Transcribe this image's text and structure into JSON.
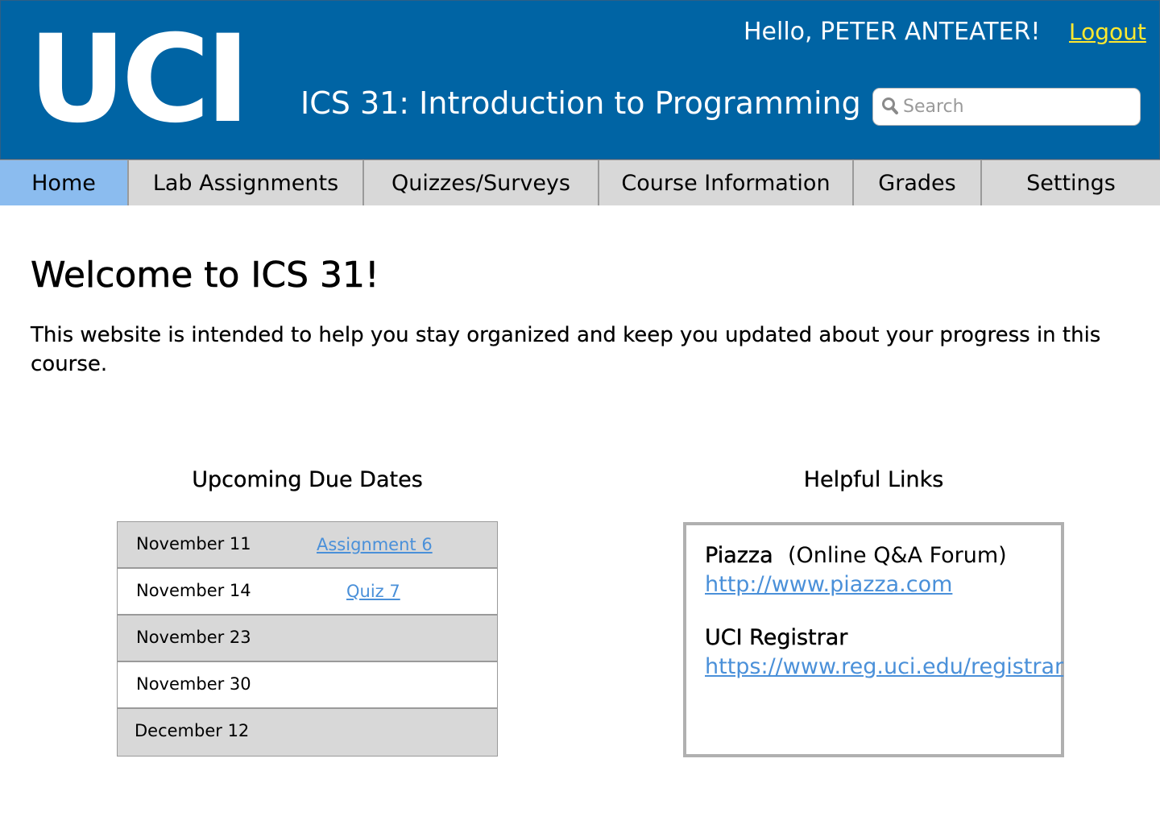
{
  "header": {
    "logo_text": "UCI",
    "course_title": "ICS 31: Introduction to Programming",
    "greeting": "Hello, PETER ANTEATER!",
    "logout_label": "Logout",
    "search_placeholder": "Search"
  },
  "nav": {
    "tabs": [
      {
        "label": "Home",
        "active": true
      },
      {
        "label": "Lab Assignments",
        "active": false
      },
      {
        "label": "Quizzes/Surveys",
        "active": false
      },
      {
        "label": "Course Information",
        "active": false
      },
      {
        "label": "Grades",
        "active": false
      },
      {
        "label": "Settings",
        "active": false
      }
    ]
  },
  "main": {
    "welcome_heading": "Welcome to ICS 31!",
    "intro_text": "This website is intended to help you stay organized and keep you updated about your progress in this course."
  },
  "due_dates": {
    "title": "Upcoming Due Dates",
    "rows": [
      {
        "date": "November 11",
        "item": "Assignment 6"
      },
      {
        "date": "November 14",
        "item": "Quiz 7"
      },
      {
        "date": "November 23",
        "item": ""
      },
      {
        "date": "November 30",
        "item": ""
      },
      {
        "date": "December 12",
        "item": ""
      }
    ]
  },
  "helpful_links": {
    "title": "Helpful Links",
    "links": [
      {
        "name": "Piazza",
        "description": "(Online Q&A Forum)",
        "url": "http://www.piazza.com"
      },
      {
        "name": "UCI Registrar",
        "description": "",
        "url": "https://www.reg.uci.edu/registrar"
      }
    ]
  },
  "colors": {
    "header_blue": "#0064a4",
    "logout_yellow": "#ffe930",
    "active_tab": "#8bbcef",
    "tab_gray": "#d8d8d8",
    "link_blue": "#4a90d9"
  },
  "icons": {
    "search": "search-icon"
  }
}
